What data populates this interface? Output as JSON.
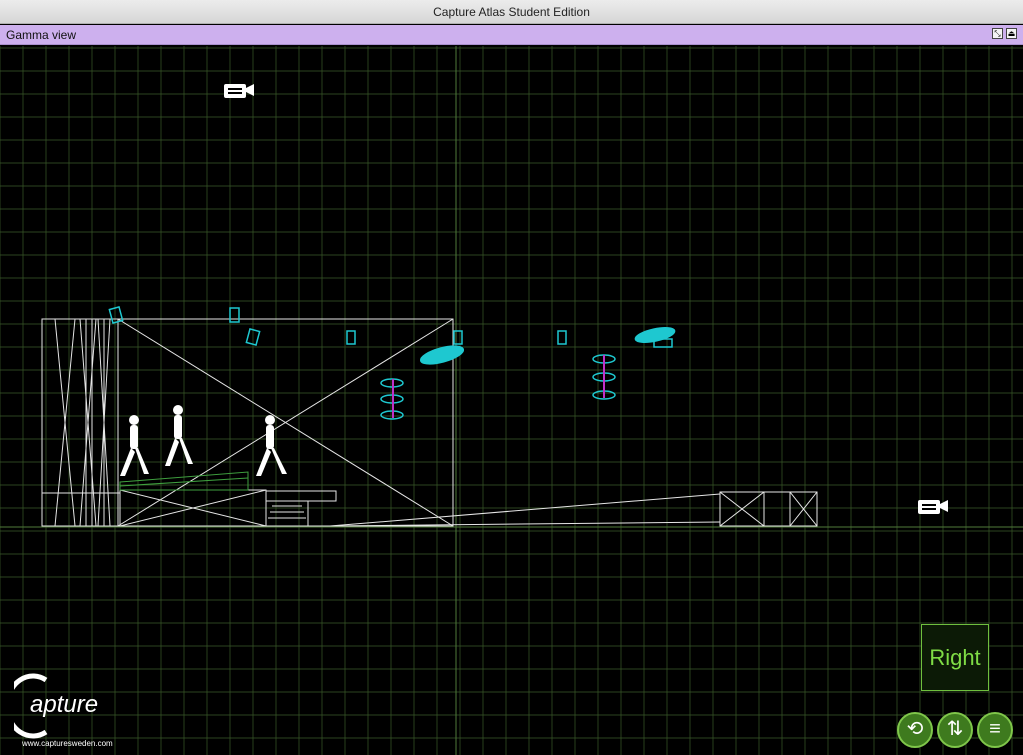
{
  "window": {
    "title": "Capture Atlas Student Edition"
  },
  "view": {
    "label": "Gamma view",
    "buttons": [
      {
        "name": "maximize-view-button",
        "glyph": "⤡"
      },
      {
        "name": "eject-view-button",
        "glyph": "⏏"
      }
    ]
  },
  "viewport": {
    "grid_color": "#3a5a2a",
    "axis_color": "#4f7a3a",
    "wire_color": "#e6e6e6",
    "fixture_color": "#1ec8d0",
    "truss_color": "#c030c8"
  },
  "right_button": {
    "label": "Right"
  },
  "toolbar": [
    {
      "name": "orbit-button",
      "icon": "rotate-arrows-icon",
      "glyph": "⟲"
    },
    {
      "name": "flip-view-button",
      "icon": "flip-arrows-icon",
      "glyph": "⇅"
    },
    {
      "name": "menu-button",
      "icon": "hamburger-menu-icon",
      "glyph": "≡"
    }
  ],
  "logo": {
    "word": "apture",
    "url": "www.capturesweden.com"
  }
}
